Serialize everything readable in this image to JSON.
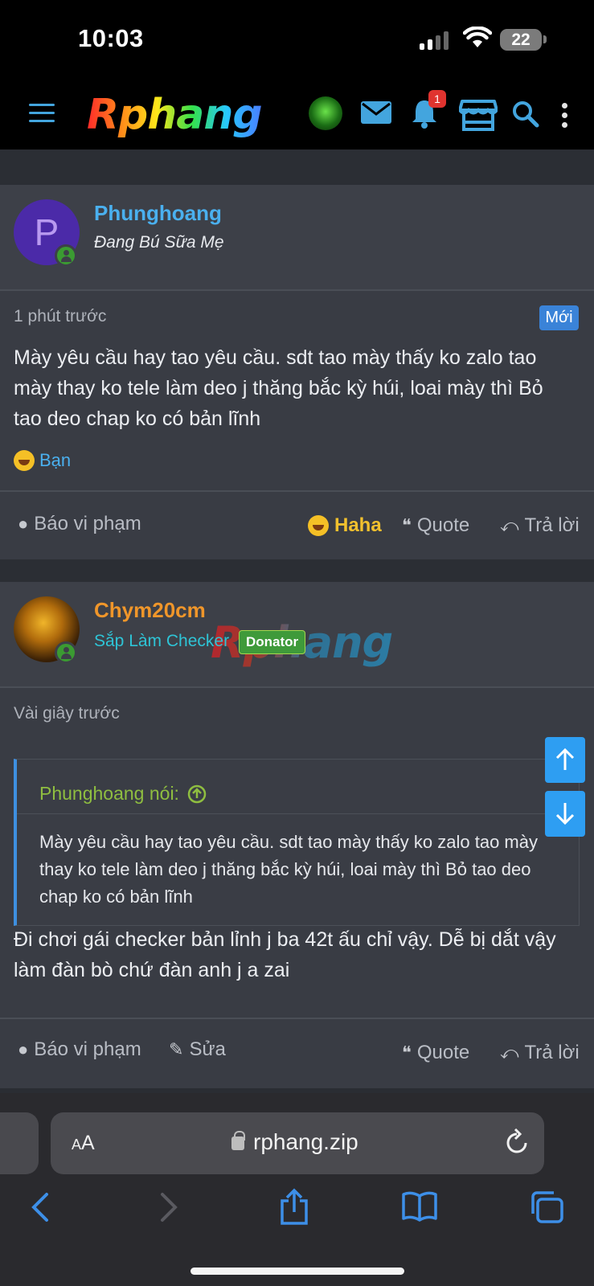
{
  "status": {
    "time": "10:03",
    "battery": "22"
  },
  "header": {
    "logo": "Rphang",
    "notification_count": "1",
    "icons": [
      "menu-icon",
      "avatar",
      "mail-icon",
      "bell-icon",
      "store-icon",
      "search-icon",
      "more-icon"
    ],
    "accent": "#43a5de"
  },
  "posts": [
    {
      "username": "Phunghoang",
      "username_color": "#4ab0ef",
      "avatar_letter": "P",
      "user_title": "Đang Bú Sữa Mẹ",
      "timestamp": "1 phút trước",
      "new_badge": "Mới",
      "body": "Mày yêu cầu hay tao yêu cầu. sdt tao mày thấy ko zalo tao mày thay ko tele làm deo j thăng bắc kỳ húi, loai mày thì Bỏ tao deo chap ko có bản lĩnh",
      "reaction_user": "Bạn",
      "actions": {
        "report": "Báo vi phạm",
        "haha": "Haha",
        "quote": "Quote",
        "reply": "Trả lời"
      }
    },
    {
      "username": "Chym20cm",
      "username_color": "#f0962a",
      "user_title": "Sắp Làm Checker",
      "user_title_color": "#2ec4d6",
      "banner": "Donator",
      "watermark": "Rphang",
      "timestamp": "Vài giây trước",
      "quote": {
        "header": "Phunghoang nói:",
        "body": "Mày yêu cầu hay tao yêu cầu. sdt tao mày thấy ko zalo tao mày thay ko tele làm deo j thăng bắc kỳ húi, loai mày thì Bỏ tao deo chap ko có bản lĩnh"
      },
      "body": "Đi chơi gái checker bản lỉnh j ba 42t ấu chỉ vậy. Dễ bị dắt vậy làm đàn bò chứ đàn anh j a zai",
      "actions": {
        "report": "Báo vi phạm",
        "edit": "Sửa",
        "quote": "Quote",
        "reply": "Trả lời"
      }
    }
  ],
  "safari": {
    "aa_label_small": "A",
    "aa_label_large": "A",
    "url": "rphang.zip"
  }
}
